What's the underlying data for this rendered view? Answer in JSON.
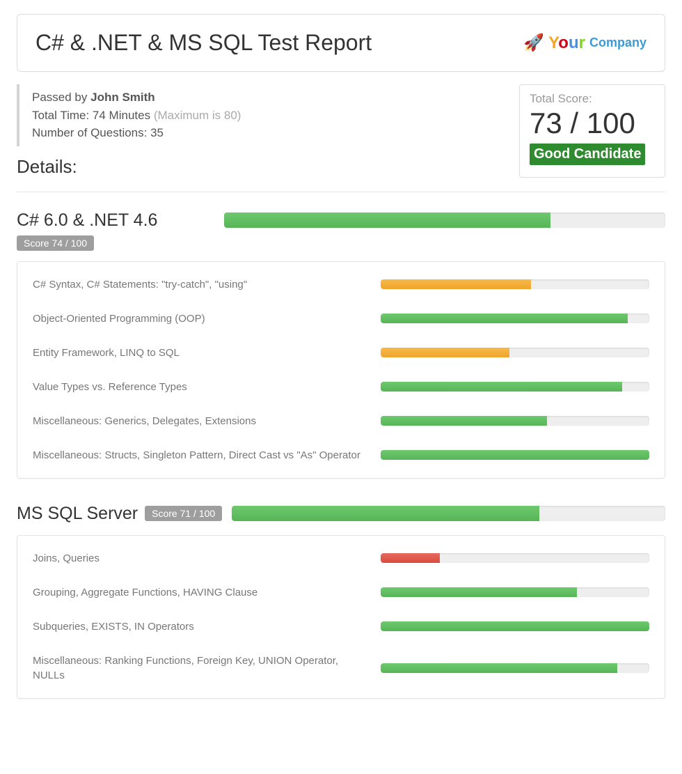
{
  "header": {
    "title": "C# & .NET & MS SQL Test Report",
    "logo_rocket": "🚀",
    "logo_your": "Your",
    "logo_company": "Company"
  },
  "meta": {
    "passed_by_prefix": "Passed by ",
    "candidate_name": "John Smith",
    "total_time_prefix": "Total Time: ",
    "total_time_value": "74 Minutes ",
    "total_time_max": "(Maximum is 80)",
    "num_questions_prefix": "Number of Questions: ",
    "num_questions_value": "35"
  },
  "totals": {
    "label": "Total Score:",
    "score_text": "73 / 100",
    "verdict": "Good Candidate"
  },
  "details_heading": "Details:",
  "sections": [
    {
      "title": "C# 6.0 & .NET 4.6",
      "score_chip": "Score 74 / 100",
      "bar_pct": 74,
      "bar_color": "green",
      "items": [
        {
          "label": "C# Syntax, C# Statements: \"try-catch\", \"using\"",
          "pct": 56,
          "color": "orange"
        },
        {
          "label": "Object-Oriented Programming (OOP)",
          "pct": 92,
          "color": "green"
        },
        {
          "label": "Entity Framework, LINQ to SQL",
          "pct": 48,
          "color": "orange"
        },
        {
          "label": "Value Types vs. Reference Types",
          "pct": 90,
          "color": "green"
        },
        {
          "label": "Miscellaneous: Generics, Delegates, Extensions",
          "pct": 62,
          "color": "green"
        },
        {
          "label": "Miscellaneous: Structs, Singleton Pattern, Direct Cast vs \"As\" Operator",
          "pct": 100,
          "color": "green"
        }
      ]
    },
    {
      "title": "MS SQL Server",
      "score_chip": "Score 71 / 100",
      "bar_pct": 71,
      "bar_color": "green",
      "items": [
        {
          "label": "Joins, Queries",
          "pct": 22,
          "color": "red"
        },
        {
          "label": "Grouping, Aggregate Functions, HAVING Clause",
          "pct": 73,
          "color": "green"
        },
        {
          "label": "Subqueries, EXISTS, IN Operators",
          "pct": 100,
          "color": "green"
        },
        {
          "label": "Miscellaneous: Ranking Functions, Foreign Key, UNION Operator, NULLs",
          "pct": 88,
          "color": "green"
        }
      ]
    }
  ],
  "chart_data": [
    {
      "type": "bar",
      "title": "C# 6.0 & .NET 4.6 — Score 74 / 100",
      "categories": [
        "C# Syntax, C# Statements: \"try-catch\", \"using\"",
        "Object-Oriented Programming (OOP)",
        "Entity Framework, LINQ to SQL",
        "Value Types vs. Reference Types",
        "Miscellaneous: Generics, Delegates, Extensions",
        "Miscellaneous: Structs, Singleton Pattern, Direct Cast vs \"As\" Operator"
      ],
      "values": [
        56,
        92,
        48,
        90,
        62,
        100
      ],
      "xlabel": "",
      "ylabel": "Score",
      "ylim": [
        0,
        100
      ]
    },
    {
      "type": "bar",
      "title": "MS SQL Server — Score 71 / 100",
      "categories": [
        "Joins, Queries",
        "Grouping, Aggregate Functions, HAVING Clause",
        "Subqueries, EXISTS, IN Operators",
        "Miscellaneous: Ranking Functions, Foreign Key, UNION Operator, NULLs"
      ],
      "values": [
        22,
        73,
        100,
        88
      ],
      "xlabel": "",
      "ylabel": "Score",
      "ylim": [
        0,
        100
      ]
    }
  ]
}
